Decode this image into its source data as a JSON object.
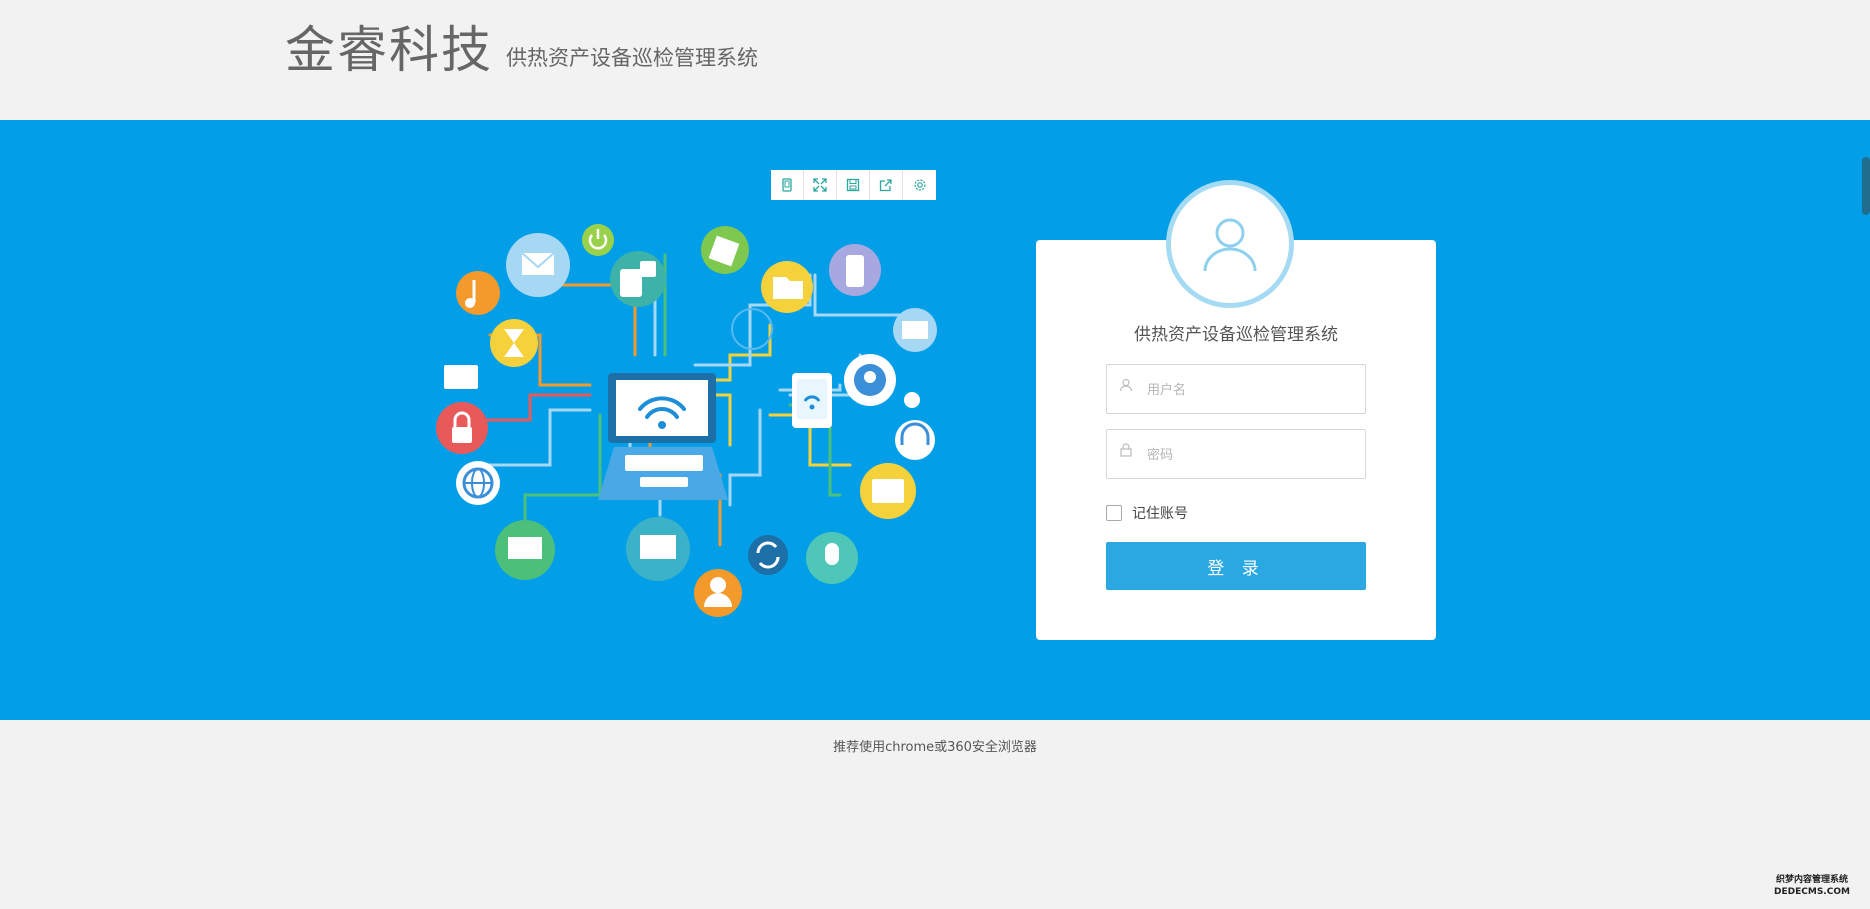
{
  "header": {
    "brand": "金睿科技",
    "subtitle": "供热资产设备巡检管理系统"
  },
  "toolbar": {
    "icons": [
      "tablet-icon",
      "expand-icon",
      "save-icon",
      "share-icon",
      "settings-icon"
    ]
  },
  "login": {
    "title": "供热资产设备巡检管理系统",
    "username_placeholder": "用户名",
    "password_placeholder": "密码",
    "remember_label": "记住账号",
    "submit_label": "登 录"
  },
  "footer": {
    "text": "推荐使用chrome或360安全浏览器"
  },
  "watermark": {
    "line1": "织梦内容管理系统",
    "line2": "DEDECMS.COM"
  },
  "colors": {
    "band": "#039ee8",
    "button": "#2aa8e2",
    "avatar_ring": "#a4dbf2",
    "background": "#f2f2f2"
  }
}
